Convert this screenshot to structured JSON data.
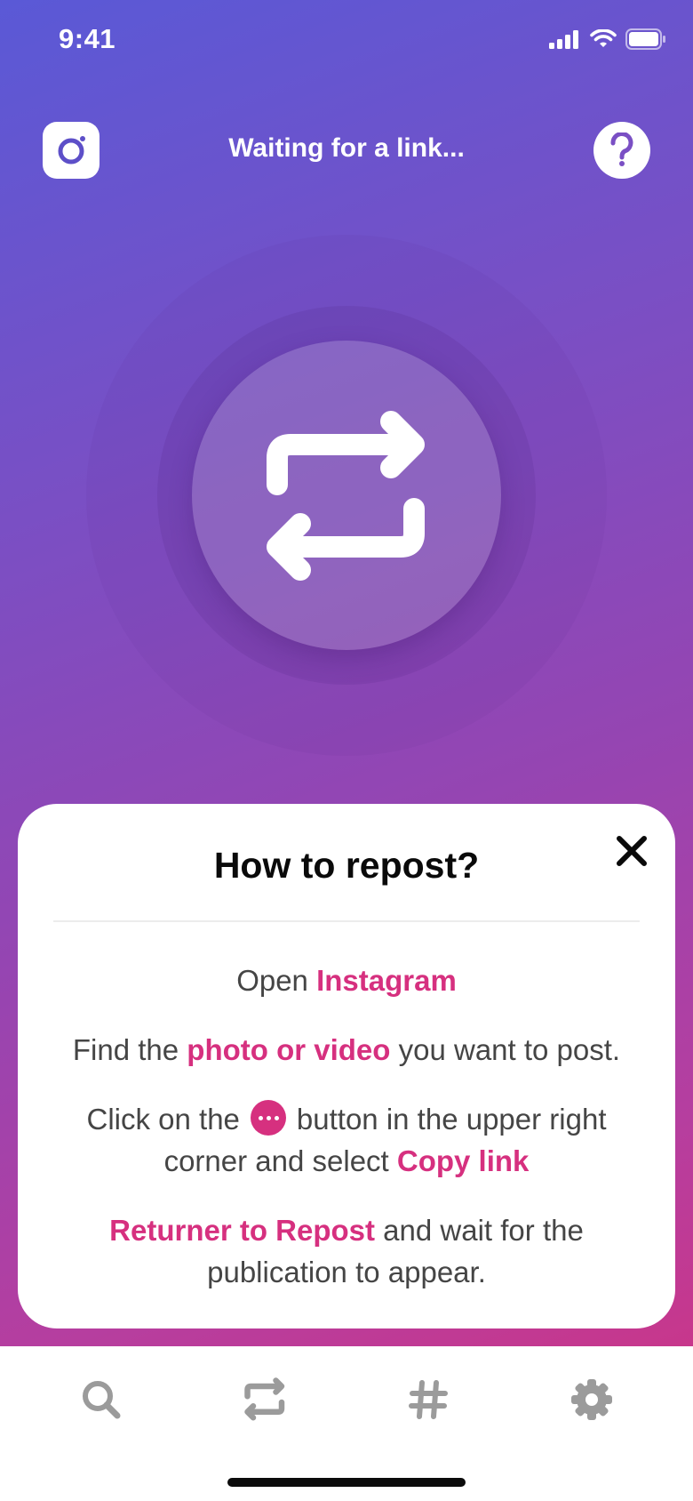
{
  "status_bar": {
    "time": "9:41",
    "icons": [
      "signal-icon",
      "wifi-icon",
      "battery-icon"
    ]
  },
  "header": {
    "title": "Waiting for a link...",
    "left_icon": "instagram-icon",
    "right_icon": "help-icon"
  },
  "hero": {
    "icon": "repost-icon"
  },
  "how_to_card": {
    "title": "How to repost?",
    "close_icon": "close-icon",
    "steps": {
      "s1": {
        "t1": "Open ",
        "h1": "Instagram"
      },
      "s2": {
        "t1": "Find the ",
        "h1": "photo or video",
        "t2": " you want to post."
      },
      "s3": {
        "t1": "Click on the",
        "t2": "button in the upper right corner and select ",
        "h1": "Copy link",
        "icon": "more-dots-icon"
      },
      "s4": {
        "h1": "Returner to Repost",
        "t1": " and wait for the publication to appear."
      }
    }
  },
  "tab_bar": {
    "items": [
      "search-icon",
      "repost-icon",
      "hashtag-icon",
      "settings-icon"
    ]
  },
  "colors": {
    "accent": "#d6307f",
    "gradient_top": "#5a59d6",
    "gradient_bottom": "#d3327f",
    "tab_icon": "#9b9b9b"
  }
}
